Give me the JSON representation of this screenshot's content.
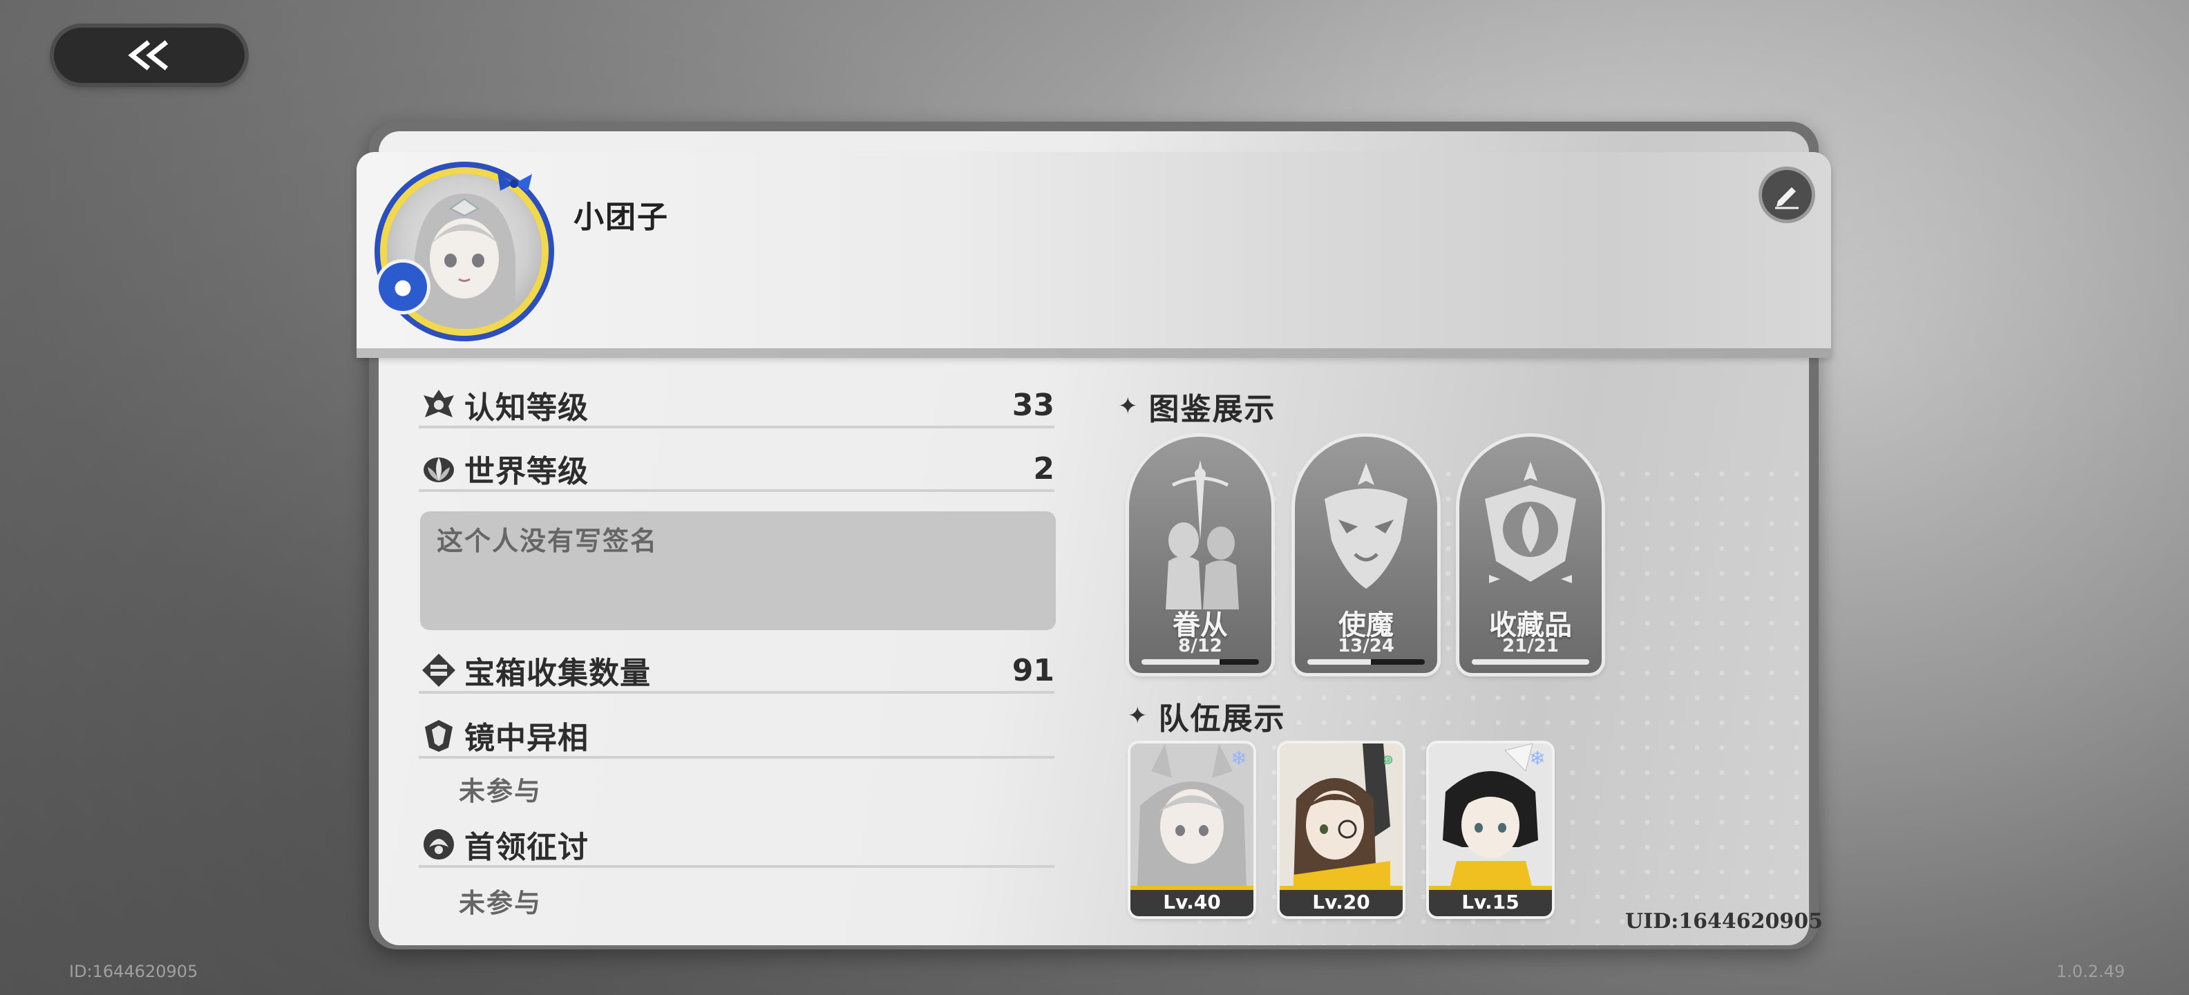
{
  "header": {
    "username": "小团子",
    "uid": "UID:1644620905"
  },
  "stats": {
    "cognition_level": {
      "label": "认知等级",
      "value": "33"
    },
    "world_level": {
      "label": "世界等级",
      "value": "2"
    },
    "signature_placeholder": "这个人没有写签名",
    "chest_count": {
      "label": "宝箱收集数量",
      "value": "91"
    },
    "mirror": {
      "label": "镜中异相",
      "status": "未参与"
    },
    "boss": {
      "label": "首领征讨",
      "status": "未参与"
    }
  },
  "collection": {
    "title": "图鉴展示",
    "items": [
      {
        "name": "眷从",
        "count": "8/12",
        "progress": 0.667
      },
      {
        "name": "使魔",
        "count": "13/24",
        "progress": 0.542
      },
      {
        "name": "收藏品",
        "count": "21/21",
        "progress": 1.0
      }
    ]
  },
  "team": {
    "title": "队伍展示",
    "members": [
      {
        "level": "Lv.40",
        "element_icon": "snowflake-icon",
        "element_color": "#8fb6ff"
      },
      {
        "level": "Lv.20",
        "element_icon": "wind-icon",
        "element_color": "#6cc48a"
      },
      {
        "level": "Lv.15",
        "element_icon": "snowflake-icon",
        "element_color": "#8fb6ff"
      }
    ]
  },
  "footer": {
    "id_text": "ID:1644620905",
    "version": "1.0.2.49"
  },
  "colors": {
    "level_strip_accent": "#e8c21e",
    "avatar_ring_gold": "#f1d84c",
    "avatar_ring_blue": "#2b4fbd"
  }
}
